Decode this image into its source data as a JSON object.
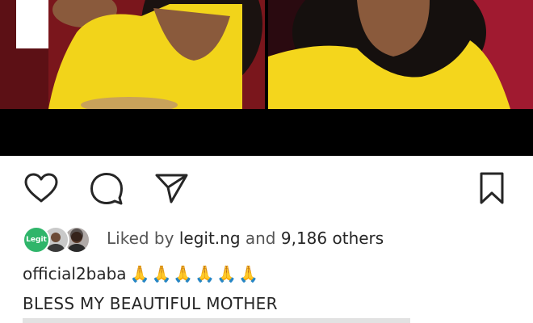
{
  "post": {
    "liked_by_label": "Liked by",
    "liked_by_user": "legit.ng",
    "and_label": "and",
    "others_count": "9,186",
    "others_label": "others",
    "avatar_badge_text": "Legit",
    "username": "official2baba",
    "emojis": "🙏🙏🙏🙏🙏🙏",
    "caption": "BLESS MY BEAUTIFUL MOTHER"
  },
  "icons": {
    "like": "heart-icon",
    "comment": "comment-icon",
    "share": "send-icon",
    "save": "bookmark-icon"
  },
  "colors": {
    "text": "#262626",
    "muted": "#555555",
    "avatar_green": "#2fb56a"
  }
}
